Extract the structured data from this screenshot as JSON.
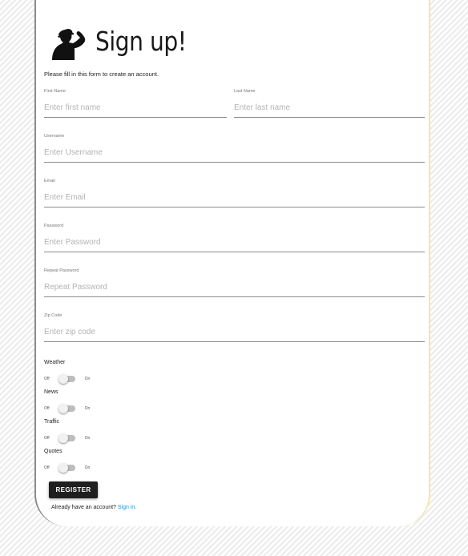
{
  "header": {
    "title": "Sign up!",
    "logo_icon": "saluting-soldier-silhouette"
  },
  "intro": "Please fill in this form to create an account.",
  "fields": {
    "first_name": {
      "label": "First Name",
      "placeholder": "Enter first name"
    },
    "last_name": {
      "label": "Last Name",
      "placeholder": "Enter last name"
    },
    "username": {
      "label": "Username",
      "placeholder": "Enter Username"
    },
    "email": {
      "label": "Email",
      "placeholder": "Enter Email"
    },
    "password": {
      "label": "Password",
      "placeholder": "Enter Password"
    },
    "repeat_password": {
      "label": "Repeat Password",
      "placeholder": "Repeat Password"
    },
    "zip_code": {
      "label": "Zip Code",
      "placeholder": "Enter zip code"
    }
  },
  "toggles": [
    {
      "title": "Weather",
      "off": "Off",
      "on": "On",
      "checked": false
    },
    {
      "title": "News",
      "off": "Off",
      "on": "On",
      "checked": false
    },
    {
      "title": "Traffic",
      "off": "Off",
      "on": "On",
      "checked": false
    },
    {
      "title": "Quotes",
      "off": "Off",
      "on": "On",
      "checked": false
    }
  ],
  "register_label": "REGISTER",
  "signin": {
    "prompt": "Already have an account?",
    "link": "Sign in."
  },
  "colors": {
    "button": "#1f1f1f",
    "link": "#2196c8",
    "card_right_border": "#f3e6a6"
  }
}
